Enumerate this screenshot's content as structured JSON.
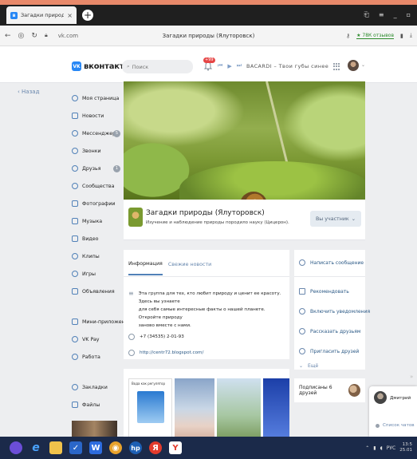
{
  "browser": {
    "tab_title": "Загадки природы (Ялу",
    "url": "vk.com",
    "page_title": "Загадки природы (Ялуторовск)",
    "reviews_label": "★ 78К отзывов"
  },
  "vk": {
    "logo_text": "вконтакте",
    "search_placeholder": "Поиск",
    "notif_count": "+99",
    "now_playing": "BACARDI – Твои губы синее"
  },
  "back_label": "Назад",
  "sidebar": {
    "items": [
      {
        "label": "Моя страница",
        "icon": "user-icon"
      },
      {
        "label": "Новости",
        "icon": "news-icon"
      },
      {
        "label": "Мессенджер",
        "icon": "messenger-icon",
        "count": "5"
      },
      {
        "label": "Звонки",
        "icon": "phone-icon"
      },
      {
        "label": "Друзья",
        "icon": "friends-icon",
        "count": "1"
      },
      {
        "label": "Сообщества",
        "icon": "communities-icon"
      },
      {
        "label": "Фотографии",
        "icon": "photos-icon"
      },
      {
        "label": "Музыка",
        "icon": "music-icon"
      },
      {
        "label": "Видео",
        "icon": "video-icon"
      },
      {
        "label": "Клипы",
        "icon": "clips-icon"
      },
      {
        "label": "Игры",
        "icon": "games-icon"
      },
      {
        "label": "Объявления",
        "icon": "ads-icon"
      },
      {
        "label": "Мини-приложения",
        "icon": "apps-icon"
      },
      {
        "label": "VK Pay",
        "icon": "vkpay-icon"
      },
      {
        "label": "Работа",
        "icon": "work-icon"
      },
      {
        "label": "Закладки",
        "icon": "star-icon"
      },
      {
        "label": "Файлы",
        "icon": "file-icon"
      }
    ]
  },
  "group": {
    "name": "Загадки природы (Ялуторовск)",
    "description": "Изучение и наблюдение природы породило науку (Цицерон).",
    "member_button": "Вы участник"
  },
  "info": {
    "tab_info": "Информация",
    "tab_news": "Свежие новости",
    "description_line1": "Эта группа для тех, кто любит природу и ценит ее красоту. Здесь вы узнаете",
    "description_line2": "для себя самые интересные факты о нашей планете. Откройте природу",
    "description_line3": "заново вместе с нами.",
    "phone": "+7 (34535) 2-01-93",
    "website": "http://centr72.blogspot.com/"
  },
  "photos": {
    "first_caption": "Вода как регулятор"
  },
  "actions": {
    "write_message": "Написать сообщение",
    "recommend": "Рекомендовать",
    "enable_notifications": "Включить уведомления",
    "tell_friends": "Рассказать друзьям",
    "invite_friends": "Пригласить друзей",
    "more": "Ещё"
  },
  "subscribed": "Подписаны 6 друзей",
  "chat": {
    "name": "Дмитрий",
    "list_label": "Список чатов"
  },
  "taskbar": {
    "lang": "РУС",
    "time": "13:5",
    "date": "25.01"
  },
  "colors": {
    "vk_blue": "#2787f5",
    "link": "#2a5885",
    "taskbar": "#1b2a4a"
  }
}
